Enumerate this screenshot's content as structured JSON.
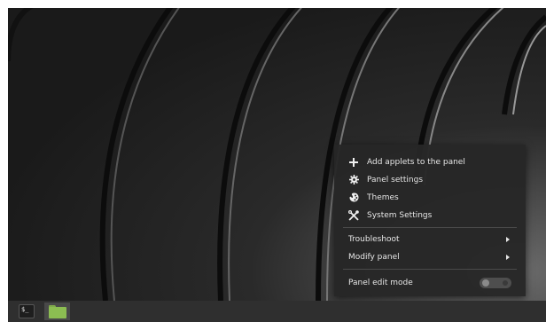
{
  "menu": {
    "items": [
      {
        "label": "Add applets to the panel",
        "icon": "plus-icon"
      },
      {
        "label": "Panel settings",
        "icon": "gear-icon"
      },
      {
        "label": "Themes",
        "icon": "themes-icon"
      },
      {
        "label": "System Settings",
        "icon": "tools-icon"
      }
    ],
    "submenus": [
      {
        "label": "Troubleshoot"
      },
      {
        "label": "Modify panel"
      }
    ],
    "edit_mode": {
      "label": "Panel edit mode",
      "enabled": false
    }
  },
  "panel": {
    "terminal_glyph": "$_",
    "apps": [
      "terminal-launcher",
      "file-manager-launcher"
    ]
  },
  "colors": {
    "menu_bg": "#262626",
    "panel_bg": "#2f2f2f",
    "folder_green": "#8cbd52"
  }
}
